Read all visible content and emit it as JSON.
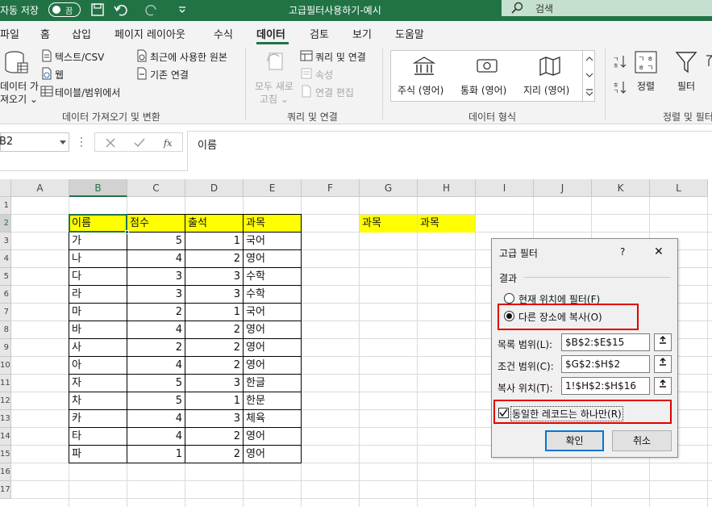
{
  "titlebar": {
    "autosave_label": "자동 저장",
    "autosave_state": "끔",
    "document_title": "고급필터사용하기-예시",
    "search_placeholder": "검색",
    "bg_color": "#217346"
  },
  "menu": {
    "tabs": [
      "파일",
      "홈",
      "삽입",
      "페이지 레이아웃",
      "수식",
      "데이터",
      "검토",
      "보기",
      "도움말"
    ],
    "active_tab": "데이터"
  },
  "ribbon": {
    "get_data": {
      "big_button_line1": "데이터 가",
      "big_button_line2": "져오기 ⌄",
      "text_csv": "텍스트/CSV",
      "web": "웹",
      "table_range": "테이블/범위에서",
      "recent_sources": "최근에 사용한 원본",
      "existing_connections": "기존 연결",
      "group_label": "데이터 가져오기 및 변환"
    },
    "queries": {
      "refresh_all_line1": "모두 새로",
      "refresh_all_line2": "고침 ⌄",
      "queries_connections": "쿼리 및 연결",
      "properties": "속성",
      "edit_links": "연결 편집",
      "group_label": "쿼리 및 연결"
    },
    "data_types": {
      "items": [
        "주식 (영어)",
        "통화 (영어)",
        "지리 (영어)"
      ],
      "group_label": "데이터 형식"
    },
    "sort_filter": {
      "sort": "정렬",
      "filter": "필터",
      "group_label": "정렬 및 필터"
    }
  },
  "formula_bar": {
    "name_box": "B2",
    "formula": "이름"
  },
  "sheet": {
    "columns": [
      "A",
      "B",
      "C",
      "D",
      "E",
      "F",
      "G",
      "H",
      "I",
      "J",
      "K",
      "L"
    ],
    "rows": [
      "1",
      "2",
      "3",
      "4",
      "5",
      "6",
      "7",
      "8",
      "9",
      "10",
      "11",
      "12",
      "13",
      "14",
      "15",
      "16",
      "17"
    ],
    "headers": [
      "이름",
      "점수",
      "출석",
      "과목"
    ],
    "records": [
      [
        "가",
        5,
        1,
        "국어"
      ],
      [
        "나",
        4,
        2,
        "영어"
      ],
      [
        "다",
        3,
        3,
        "수학"
      ],
      [
        "라",
        3,
        3,
        "수학"
      ],
      [
        "마",
        2,
        1,
        "국어"
      ],
      [
        "바",
        4,
        2,
        "영어"
      ],
      [
        "사",
        2,
        2,
        "영어"
      ],
      [
        "아",
        4,
        2,
        "영어"
      ],
      [
        "자",
        5,
        3,
        "한글"
      ],
      [
        "차",
        5,
        1,
        "한문"
      ],
      [
        "카",
        4,
        3,
        "체육"
      ],
      [
        "타",
        4,
        2,
        "영어"
      ],
      [
        "파",
        1,
        2,
        "영어"
      ]
    ],
    "criteria_headers": [
      "과목",
      "과목"
    ],
    "highlight_color": "#ffff00"
  },
  "dialog": {
    "title": "고급 필터",
    "help": "?",
    "close": "✕",
    "result_label": "결과",
    "option_in_place": "현재 위치에 필터(F)",
    "option_copy": "다른 장소에 복사(O)",
    "selected_option": "copy",
    "list_range_label": "목록 범위(L):",
    "list_range_value": "$B$2:$E$15",
    "criteria_range_label": "조건 범위(C):",
    "criteria_range_value": "$G$2:$H$2",
    "copy_to_label": "복사 위치(T):",
    "copy_to_value": "1!$H$2:$H$16",
    "unique_label": "동일한 레코드는 하나만(R)",
    "unique_checked": true,
    "ok": "확인",
    "cancel": "취소",
    "highlight_color": "#e00000"
  }
}
